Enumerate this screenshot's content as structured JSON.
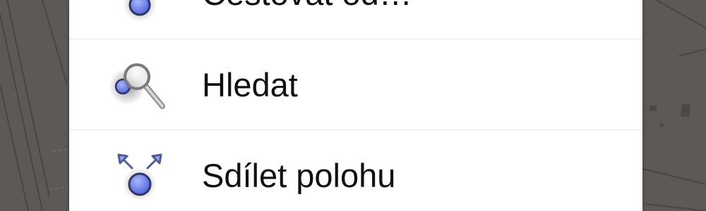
{
  "colors": {
    "map_background": "#5e5957",
    "menu_background": "#ffffff",
    "divider": "#e6e6e6",
    "label_text": "#111111",
    "location_dot": "#6d7ee8"
  },
  "menu": {
    "items": [
      {
        "label": "Cestovat od…",
        "icon": "route-from-location-icon"
      },
      {
        "label": "Hledat",
        "icon": "search-nearby-icon"
      },
      {
        "label": "Sdílet polohu",
        "icon": "share-location-icon"
      }
    ]
  }
}
